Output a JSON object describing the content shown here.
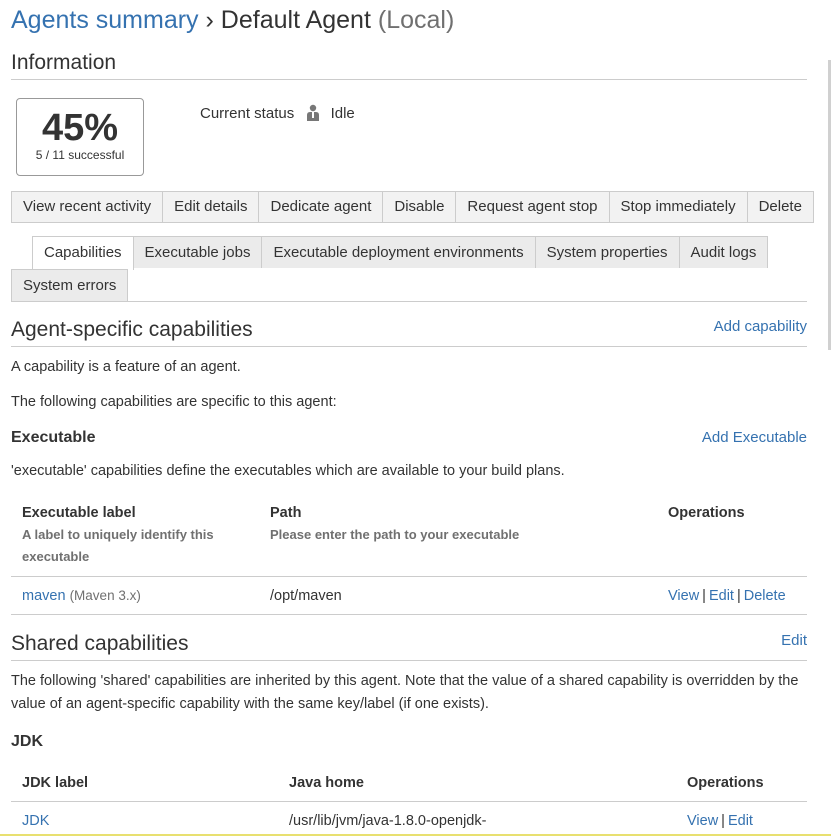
{
  "header": {
    "crumb": "Agents summary",
    "separator": "›",
    "agent_name": "Default Agent",
    "agent_type": "(Local)"
  },
  "information": {
    "heading": "Information",
    "success_percent": "45%",
    "success_detail": "5 / 11 successful",
    "status_label": "Current status",
    "status_icon": "agent-idle-icon",
    "status_value": "Idle"
  },
  "toolbar": {
    "buttons": [
      "View recent activity",
      "Edit details",
      "Dedicate agent",
      "Disable",
      "Request agent stop",
      "Stop immediately",
      "Delete"
    ]
  },
  "tabs": {
    "row1": [
      "Capabilities",
      "Executable jobs",
      "Executable deployment environments",
      "System properties",
      "Audit logs"
    ],
    "row2": [
      "System errors"
    ],
    "active": "Capabilities"
  },
  "agent_caps": {
    "heading": "Agent-specific capabilities",
    "add_link": "Add capability",
    "desc1": "A capability is a feature of an agent.",
    "desc2": "The following capabilities are specific to this agent:",
    "section": "Executable",
    "section_add": "Add Executable",
    "section_desc": "'executable' capabilities define the executables which are available to your build plans.",
    "columns": {
      "label": "Executable label",
      "label_hint": "A label to uniquely identify this executable",
      "path": "Path",
      "path_hint": "Please enter the path to your executable",
      "ops": "Operations"
    },
    "rows": [
      {
        "label": "maven",
        "type": "(Maven 3.x)",
        "path": "/opt/maven",
        "ops": [
          "View",
          "Edit",
          "Delete"
        ]
      }
    ]
  },
  "shared_caps": {
    "heading": "Shared capabilities",
    "edit_link": "Edit",
    "desc": "The following 'shared' capabilities are inherited by this agent. Note that the value of a shared capability is overridden by the value of an agent-specific capability with the same key/label (if one exists).",
    "section": "JDK",
    "columns": {
      "label": "JDK label",
      "path": "Java home",
      "ops": "Operations"
    },
    "rows": [
      {
        "label": "JDK",
        "path": "/usr/lib/jvm/java-1.8.0-openjdk-",
        "ops": [
          "View",
          "Edit"
        ]
      }
    ]
  }
}
